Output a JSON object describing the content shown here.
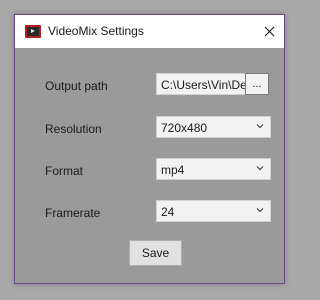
{
  "window": {
    "title": "VideoMix Settings",
    "app_icon": "film-icon",
    "close_icon": "close-icon"
  },
  "form": {
    "output_path": {
      "label": "Output path",
      "value": "C:\\Users\\Vin\\Desktop",
      "browse_label": "..."
    },
    "resolution": {
      "label": "Resolution",
      "value": "720x480"
    },
    "format": {
      "label": "Format",
      "value": "mp4"
    },
    "framerate": {
      "label": "Framerate",
      "value": "24"
    }
  },
  "actions": {
    "save_label": "Save"
  },
  "colors": {
    "background": "#a9a9a9",
    "window_border": "#6a4a86",
    "app_icon": "#b21f1f"
  }
}
